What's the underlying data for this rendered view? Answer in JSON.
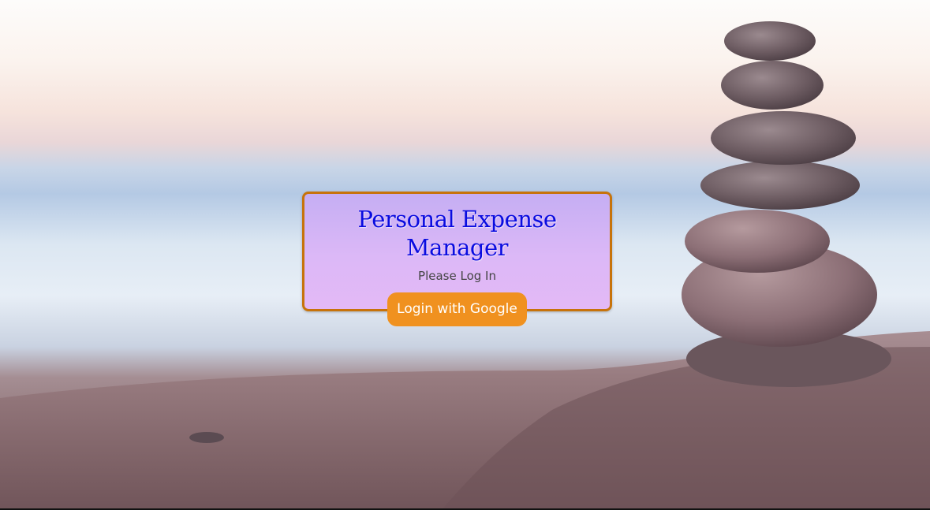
{
  "card": {
    "title": "Personal Expense Manager",
    "subtitle": "Please Log In",
    "login_button_label": "Login with Google"
  },
  "colors": {
    "title": "#0a0ce0",
    "button": "#f0911f",
    "card_border": "#c7730a",
    "card_background": "#d9b6f6"
  }
}
